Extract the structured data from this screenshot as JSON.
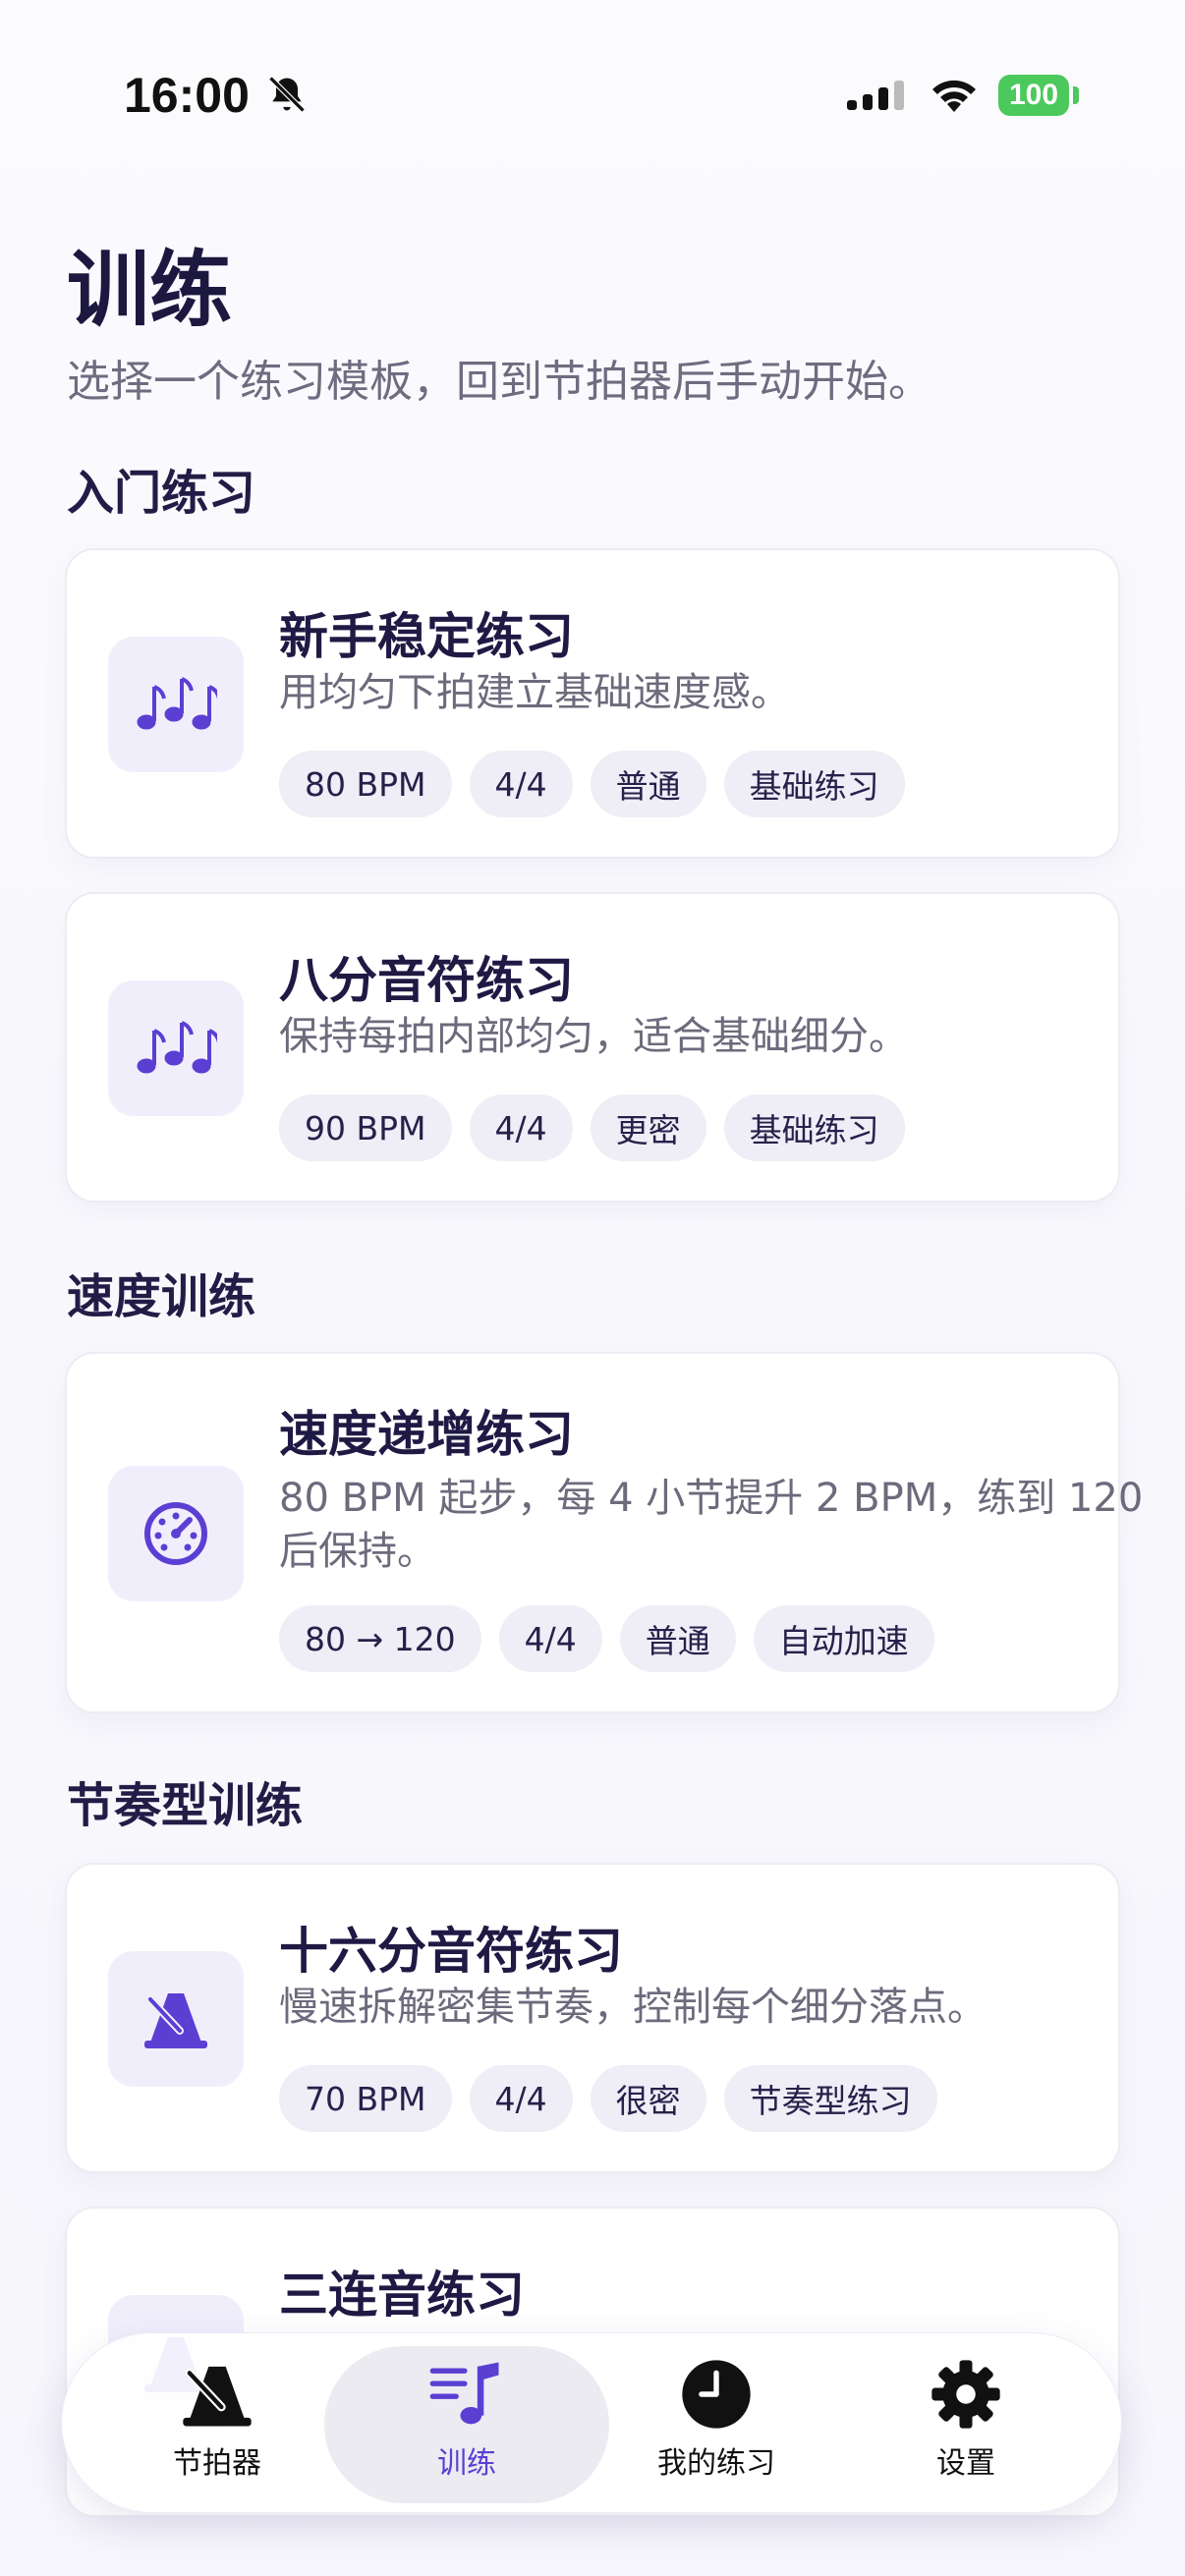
{
  "status_bar": {
    "time": "16:00",
    "battery": "100",
    "icons": [
      "bell-slash-icon",
      "signal-icon",
      "wifi-icon",
      "battery-icon"
    ]
  },
  "header": {
    "title": "训练",
    "subtitle": "选择一个练习模板，回到节拍器后手动开始。"
  },
  "sections": [
    {
      "title": "入门练习",
      "cards": [
        {
          "title": "新手稳定练习",
          "desc": "用均匀下拍建立基础速度感。",
          "icon": "music-notes-icon",
          "tags": [
            "80 BPM",
            "4/4",
            "普通",
            "基础练习"
          ]
        },
        {
          "title": "八分音符练习",
          "desc": "保持每拍内部均匀，适合基础细分。",
          "icon": "music-notes-icon",
          "tags": [
            "90 BPM",
            "4/4",
            "更密",
            "基础练习"
          ]
        }
      ]
    },
    {
      "title": "速度训练",
      "cards": [
        {
          "title": "速度递增练习",
          "desc": "80 BPM 起步，每 4 小节提升 2 BPM，练到 120 后保持。",
          "icon": "speedometer-icon",
          "tags": [
            "80 → 120",
            "4/4",
            "普通",
            "自动加速"
          ]
        }
      ]
    },
    {
      "title": "节奏型训练",
      "cards": [
        {
          "title": "十六分音符练习",
          "desc": "慢速拆解密集节奏，控制每个细分落点。",
          "icon": "metronome-icon",
          "tags": [
            "70 BPM",
            "4/4",
            "很密",
            "节奏型练习"
          ]
        },
        {
          "title": "三连音练习",
          "desc": "",
          "icon": "metronome-icon",
          "tags": []
        }
      ]
    }
  ],
  "tabbar": {
    "tabs": [
      {
        "label": "节拍器",
        "icon": "metronome-icon",
        "active": false
      },
      {
        "label": "训练",
        "icon": "music-list-icon",
        "active": true
      },
      {
        "label": "我的练习",
        "icon": "clock-icon",
        "active": false
      },
      {
        "label": "设置",
        "icon": "gear-icon",
        "active": false
      }
    ]
  },
  "colors": {
    "accent": "#5b3fd3",
    "icon_bg": "#f1eefc",
    "tag_bg": "#efedf6",
    "battery_green": "#4cc95c"
  }
}
